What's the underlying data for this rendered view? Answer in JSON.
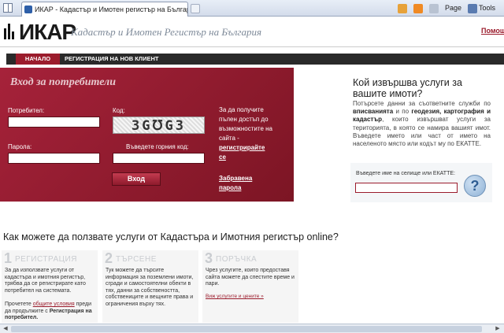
{
  "browser": {
    "tab_title": "ИКАР - Кадастър и Имотен регистър на България",
    "page_label": "Page",
    "tools_label": "Tools"
  },
  "header": {
    "logo_main": "ИКАР",
    "tagline": "Кадастър и Имотен Регистър на България",
    "help_link": "Помощ"
  },
  "nav": {
    "items": [
      {
        "label": "НАЧАЛО"
      },
      {
        "label": "РЕГИСТРАЦИЯ НА НОВ КЛИЕНТ"
      }
    ]
  },
  "login": {
    "title": "Вход за потребители",
    "username_label": "Потребител:",
    "password_label": "Парола:",
    "code_label": "Код:",
    "captcha_text": "3G℧G3",
    "captcha_prompt": "Въведете горния код:",
    "submit_label": "Вход",
    "side_text_1": "За да получите пълен достъп до възможностите на сайта -",
    "register_link": "регистрирайте се",
    "forgot_link": "Забравена парола"
  },
  "info": {
    "title": "Кой извършва услуги за вашите имоти?",
    "body_1": "Потърсете данни за съответните служби по ",
    "body_bold_1": "вписванията",
    "body_2": " и по ",
    "body_bold_2": "геодезия, картография и кадастър",
    "body_3": ", които извършват услуги за територията, в която се намира вашият имот. Въведете името или част от името на населеното място или кодът му по ЕКАТТЕ.",
    "search_label": "Въведете име на селище или ЕКАТТЕ:",
    "help_icon": "?"
  },
  "howto": {
    "title": "Как можете да ползвате услуги от Кадастъра и Имотния регистър online?",
    "steps": [
      {
        "num": "1",
        "head": "РЕГИСТРАЦИЯ",
        "text": "За да използвате услуги от кадастъра и имотния регистър, трябва да се регистрирате като потребител на системата.",
        "text2a": "Прочетете ",
        "text2_link": "общите условия",
        "text2b": " преди да продължите с ",
        "text2_bold": "Регистрация на потребител."
      },
      {
        "num": "2",
        "head": "ТЪРСЕНЕ",
        "text": "Тук можете да търсите информация за поземлени имоти, сгради и самостоятелни обекти в тях, данни за собствеността, собствениците и вещните права и ограничения върху тях."
      },
      {
        "num": "3",
        "head": "ПОРЪЧКА",
        "text": "Чрез услугите, които предоставя сайта можете да спестите време и пари.",
        "link": "Виж услугите и цените »"
      }
    ]
  },
  "colors": {
    "accent": "#9b1c2c",
    "nav_bg": "#2a2a2a"
  }
}
